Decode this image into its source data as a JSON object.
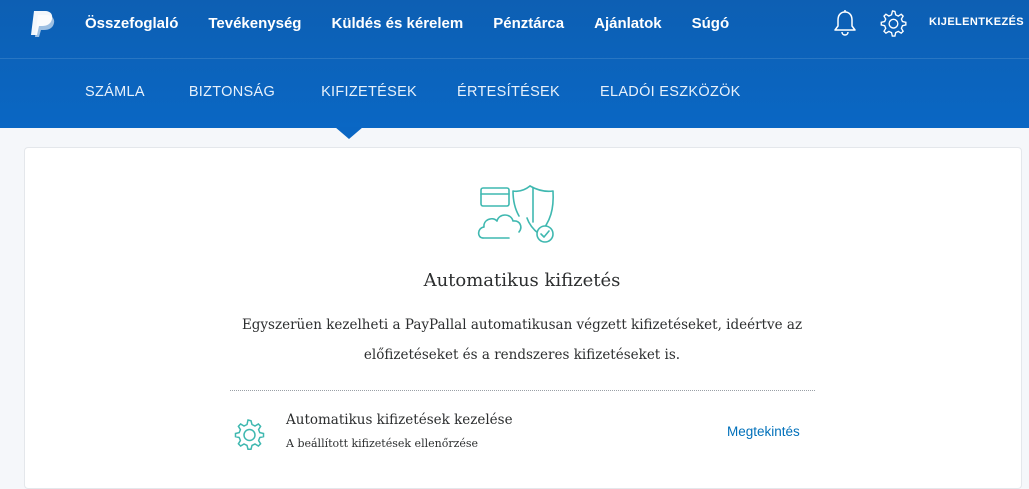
{
  "colors": {
    "header": "#0a63bd",
    "accent": "#0070ba",
    "icon_teal": "#3fb8b0"
  },
  "topnav": {
    "items": [
      {
        "label": "Összefoglaló"
      },
      {
        "label": "Tevékenység"
      },
      {
        "label": "Küldés és kérelem"
      },
      {
        "label": "Pénztárca"
      },
      {
        "label": "Ajánlatok"
      },
      {
        "label": "Súgó"
      }
    ],
    "logout_label": "KIJELENTKEZÉS",
    "icons": [
      "paypal-logo",
      "bell-icon",
      "gear-icon"
    ]
  },
  "subnav": {
    "items": [
      {
        "label": "SZÁMLA"
      },
      {
        "label": "BIZTONSÁG"
      },
      {
        "label": "KIFIZETÉSEK"
      },
      {
        "label": "ÉRTESÍTÉSEK"
      },
      {
        "label": "ELADÓI ESZKÖZÖK"
      }
    ],
    "active": "KIFIZETÉSEK"
  },
  "main": {
    "title": "Automatikus kifizetés",
    "description_line1": "Egyszerüen kezelheti a PayPallal automatikusan végzett kifizetéseket, ideértve az",
    "description_line2": "előfizetéseket és a rendszeres kifizetéseket is.",
    "row": {
      "title": "Automatikus kifizetések kezelése",
      "subtitle": "A beállított kifizetések ellenőrzése",
      "link": "Megtekintés"
    }
  }
}
